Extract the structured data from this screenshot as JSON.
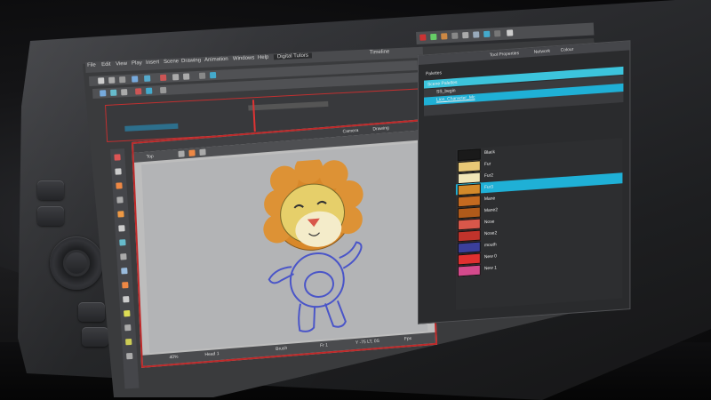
{
  "menu": {
    "items": [
      "File",
      "Edit",
      "View",
      "Play",
      "Insert",
      "Scene",
      "Drawing",
      "Animation",
      "Windows",
      "Help"
    ],
    "workspace_select": "Digital Tutors"
  },
  "timeline": {
    "tab_label": "Timeline"
  },
  "camera_view": {
    "tab_camera": "Camera",
    "tab_drawing": "Drawing",
    "top_label": "Top",
    "status": {
      "zoom": "40%",
      "layer": "Head 1",
      "tool": "Brush",
      "frame": "Fr 1",
      "coords": "Y -75 LT, 0S",
      "mode": "Fps"
    }
  },
  "right_panel": {
    "tabs": [
      "Tool Properties",
      "Network",
      "Colour"
    ],
    "palette_section": "Palettes",
    "scene_palettes_label": "Scene Palettes",
    "palettes": [
      {
        "label": "SS_begin",
        "selected": false
      },
      {
        "label": "Lion_Character_Mc",
        "selected": true
      }
    ],
    "colors": [
      {
        "name": "Black",
        "hex": "#1a1a1a",
        "selected": false
      },
      {
        "name": "Fur",
        "hex": "#e8c876",
        "selected": false
      },
      {
        "name": "Fur2",
        "hex": "#f0e6b8",
        "selected": false
      },
      {
        "name": "Fur3",
        "hex": "#d38a2a",
        "selected": true
      },
      {
        "name": "Mane",
        "hex": "#c46a20",
        "selected": false
      },
      {
        "name": "Mane2",
        "hex": "#b05a1a",
        "selected": false
      },
      {
        "name": "Nose",
        "hex": "#d8574a",
        "selected": false
      },
      {
        "name": "Nose2",
        "hex": "#c0332b",
        "selected": false
      },
      {
        "name": "mouth",
        "hex": "#3b3f9a",
        "selected": false
      },
      {
        "name": "New 0",
        "hex": "#e03030",
        "selected": false
      },
      {
        "name": "New 1",
        "hex": "#d44a8c",
        "selected": false
      }
    ]
  },
  "accent_colors": {
    "selection_blue": "#1fb0d6",
    "panel_border_red": "#c02828",
    "lion_outline_blue": "#4a55c8"
  }
}
